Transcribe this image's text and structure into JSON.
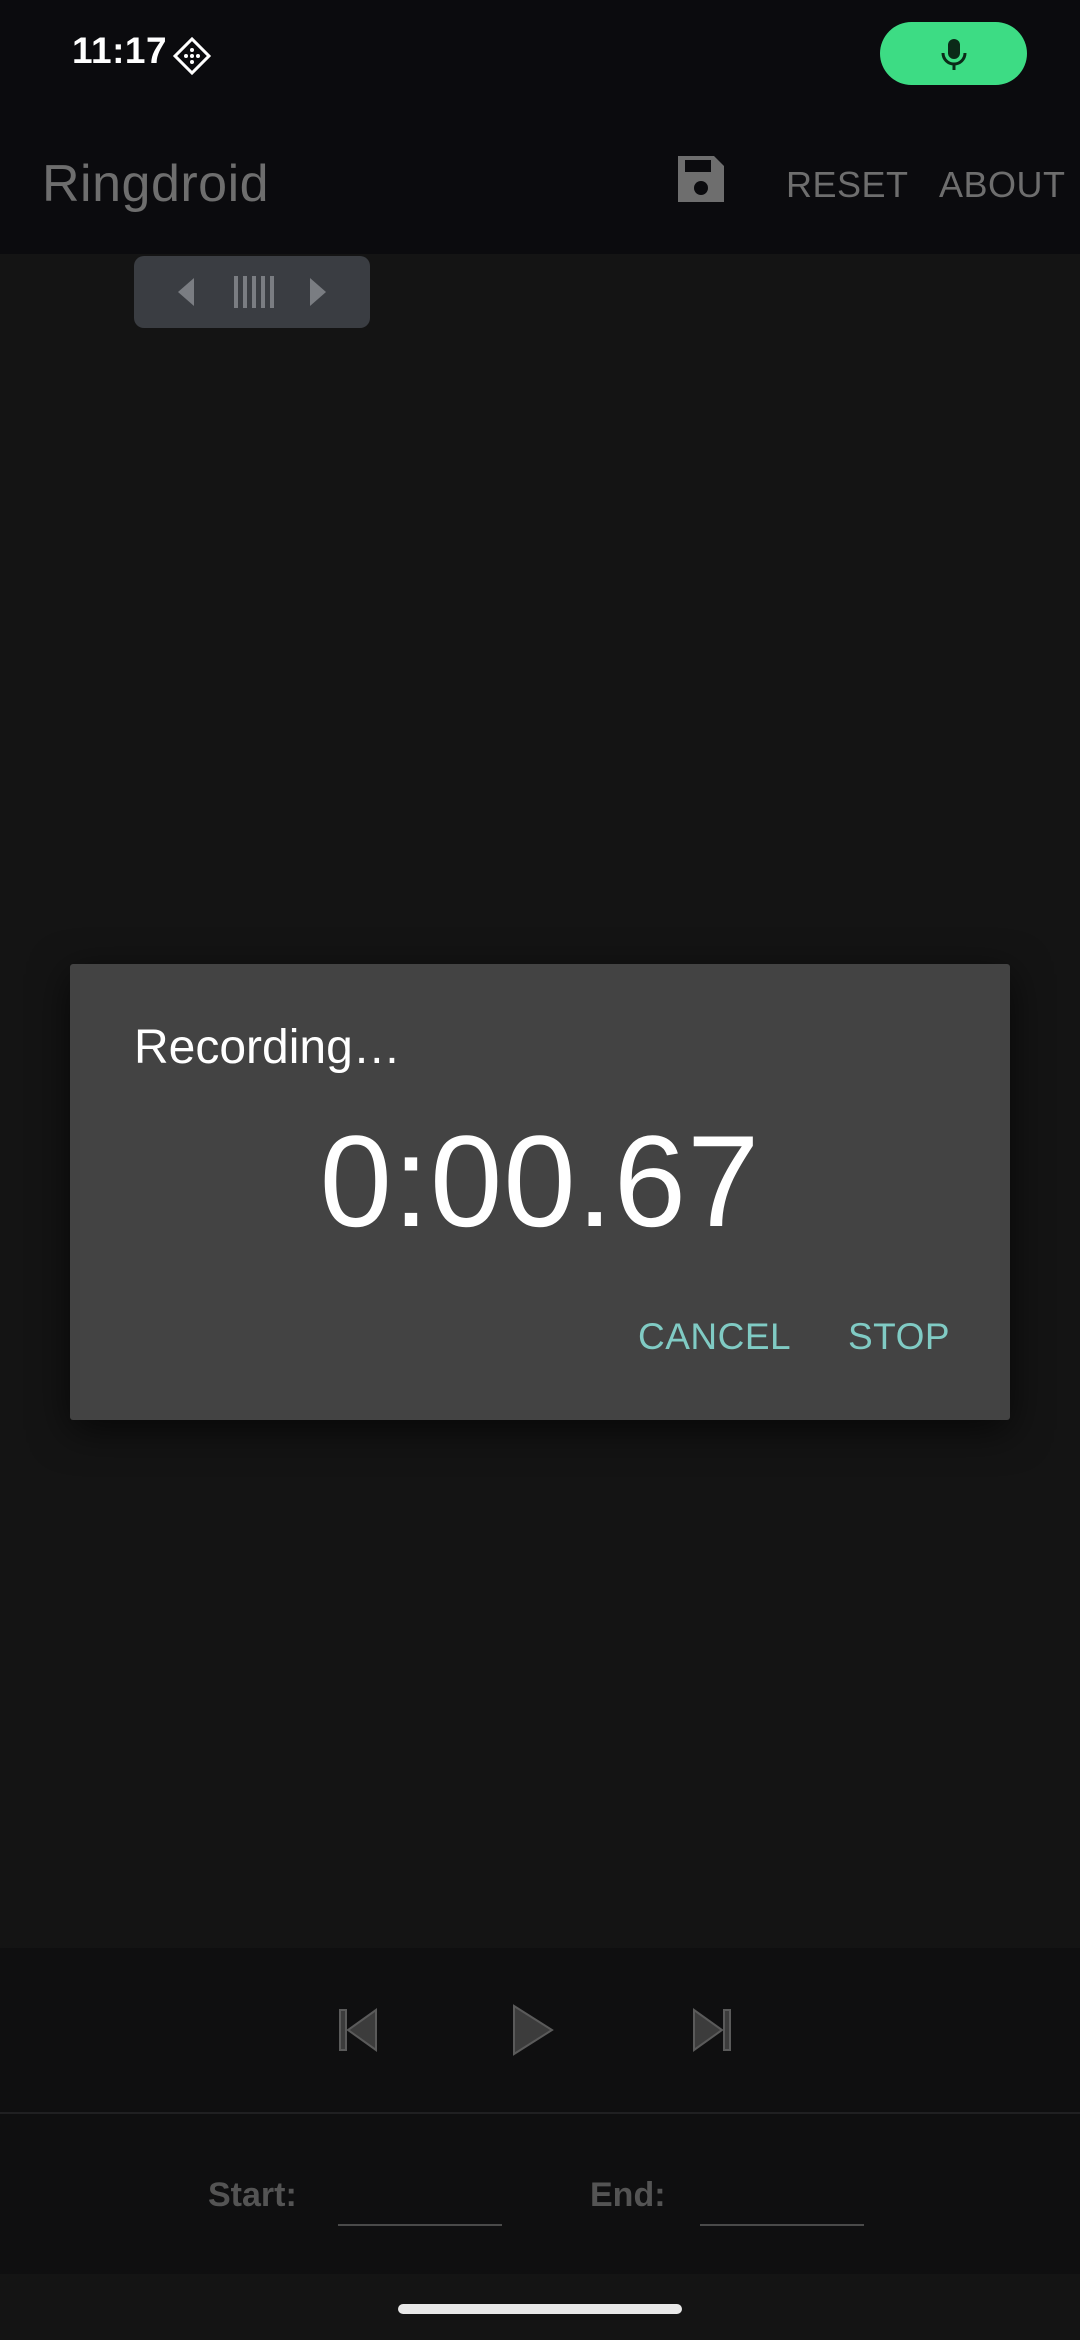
{
  "status_bar": {
    "time": "11:17",
    "notification_icon": "diamond-grid-icon",
    "mic_indicator_icon": "mic-icon",
    "mic_indicator_color": "#3ddc84"
  },
  "app_bar": {
    "title": "Ringdroid",
    "save_icon": "floppy-disk-icon",
    "reset_label": "RESET",
    "about_label": "ABOUT"
  },
  "zoom_control": {
    "left_icon": "chevron-left-icon",
    "handle_icon": "grip-lines-icon",
    "right_icon": "chevron-right-icon"
  },
  "dialog": {
    "title": "Recording…",
    "timer": "0:00.67",
    "cancel_label": "CANCEL",
    "stop_label": "STOP",
    "accent_color": "#80cbc4"
  },
  "transport": {
    "prev_icon": "skip-previous-icon",
    "play_icon": "play-icon",
    "next_icon": "skip-next-icon"
  },
  "markers": {
    "start_label": "Start:",
    "start_value": "",
    "end_label": "End:",
    "end_value": ""
  }
}
